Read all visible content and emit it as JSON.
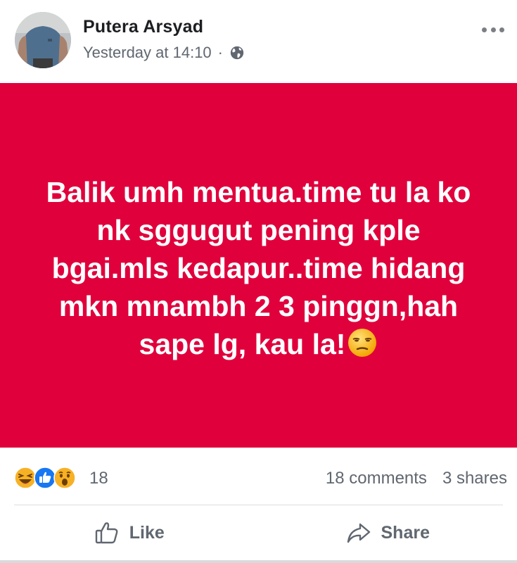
{
  "post": {
    "author": "Putera Arsyad",
    "timestamp": "Yesterday at 14:10",
    "separator": "·",
    "privacy_icon": "globe-icon",
    "more_icon": "more-horizontal-icon",
    "avatar_icon": "profile-photo"
  },
  "status": {
    "text": "Balik umh mentua.time tu la ko nk sggugut pening kple bgai.mls kedapur..time hidang mkn mnambh 2 3 pinggn,hah sape lg, kau la!",
    "emoji": "unamused-face-emoji",
    "background_color": "#e0003c"
  },
  "reactions": {
    "icons": [
      "haha-icon",
      "like-icon",
      "wow-icon"
    ],
    "count": "18",
    "comments": "18 comments",
    "shares": "3 shares"
  },
  "actions": {
    "like_label": "Like",
    "like_icon": "thumbs-up-icon",
    "share_label": "Share",
    "share_icon": "share-arrow-icon"
  },
  "colors": {
    "card": "#e0003c",
    "text_primary": "#1c1e21",
    "text_secondary": "#606770",
    "like_blue": "#1877f2",
    "emoji_yellow": "#f7b125"
  }
}
